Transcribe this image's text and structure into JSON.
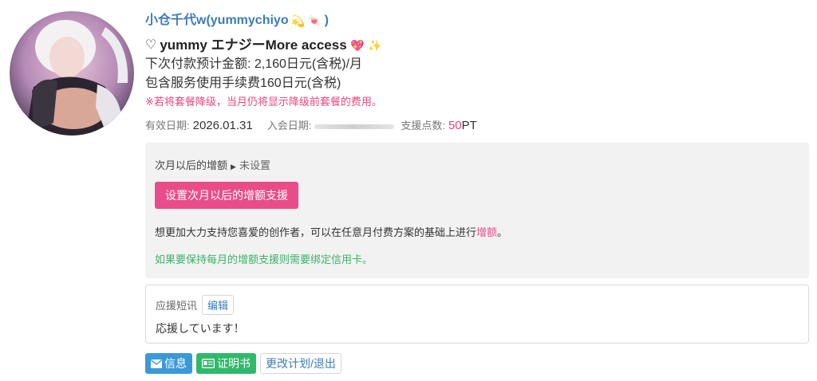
{
  "creator": {
    "name": "小仓千代w(yummychiyo",
    "name_suffix": ")",
    "emoji_1": "💫",
    "emoji_2": "🍬"
  },
  "plan": {
    "heart_prefix": "♡",
    "title": "yummy エナジーMore access",
    "emoji_1": "💖",
    "emoji_2": "✨",
    "next_payment": "下次付款预计金额: 2,160日元(含税)/月",
    "service_fee": "包含服务使用手续费160日元(含税)",
    "downgrade_note": "※若将套餐降级，当月仍将显示降级前套餐的费用。"
  },
  "meta": {
    "valid_label": "有效日期:",
    "valid_value": "2026.01.31",
    "join_label": "入会日期:",
    "support_label": "支援点数:",
    "support_points": "50",
    "support_unit": "PT"
  },
  "upgrade": {
    "status_label": "次月以后的增额",
    "status_value": "未设置",
    "button_label": "设置次月以后的增额支援",
    "desc_main": "想更加大力支持您喜爱的创作者，可以在任意月付费方案的基础上进行",
    "desc_link": "增额",
    "desc_end": "。",
    "credit_note": "如果要保持每月的增额支援则需要绑定信用卡。"
  },
  "message": {
    "label": "应援短讯",
    "edit_label": "编辑",
    "text": "応援しています！"
  },
  "actions": {
    "message_label": "信息",
    "certificate_label": "证明书",
    "change_plan_label": "更改计划/退出"
  },
  "colors": {
    "accent_pink": "#ea4c89",
    "link_blue": "#3c7cb8",
    "green": "#2fb96b",
    "button_blue": "#3a99d8"
  }
}
